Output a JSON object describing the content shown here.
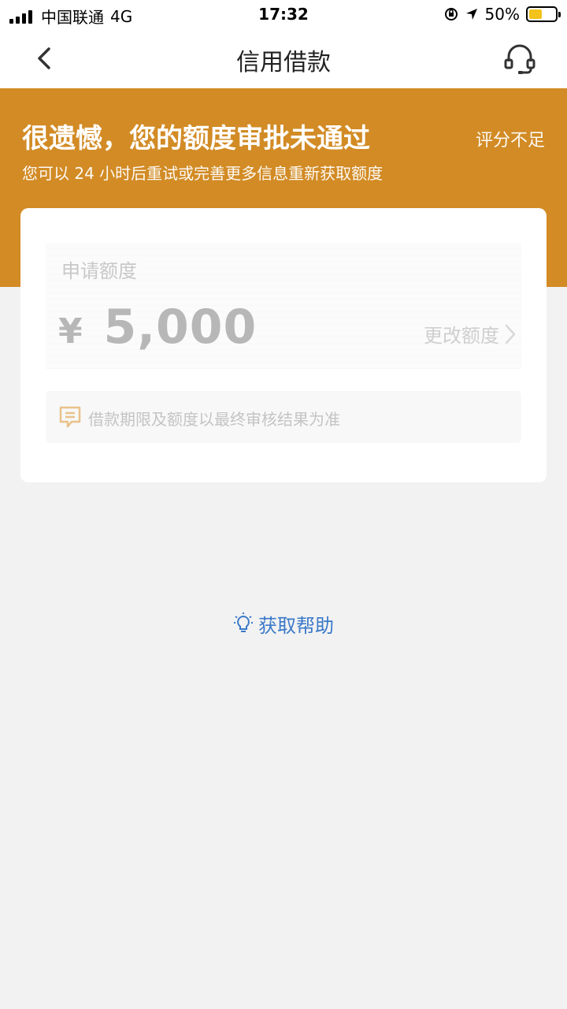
{
  "status_bar": {
    "carrier": "中国联通",
    "network": "4G",
    "time": "17:32",
    "battery_percent": "50%",
    "battery_fill_color": "#f3c21b",
    "icons": [
      "signal-icon",
      "orientation-lock-icon",
      "location-arrow-icon",
      "battery-icon"
    ]
  },
  "nav": {
    "title": "信用借款",
    "back_icon": "chevron-left-icon",
    "service_icon": "headset-icon"
  },
  "banner": {
    "title": "很遗憾，您的额度审批未通过",
    "badge": "评分不足",
    "subtitle": "您可以 24 小时后重试或完善更多信息重新获取额度",
    "bg_color": "#d28b25"
  },
  "card": {
    "amount_label": "申请额度",
    "currency": "¥",
    "amount": "5,000",
    "change_label": "更改额度",
    "note": "借款期限及额度以最终审核结果为准",
    "note_icon": "message-icon"
  },
  "help": {
    "label": "获取帮助",
    "icon": "lightbulb-icon",
    "color": "#3a79c9"
  }
}
